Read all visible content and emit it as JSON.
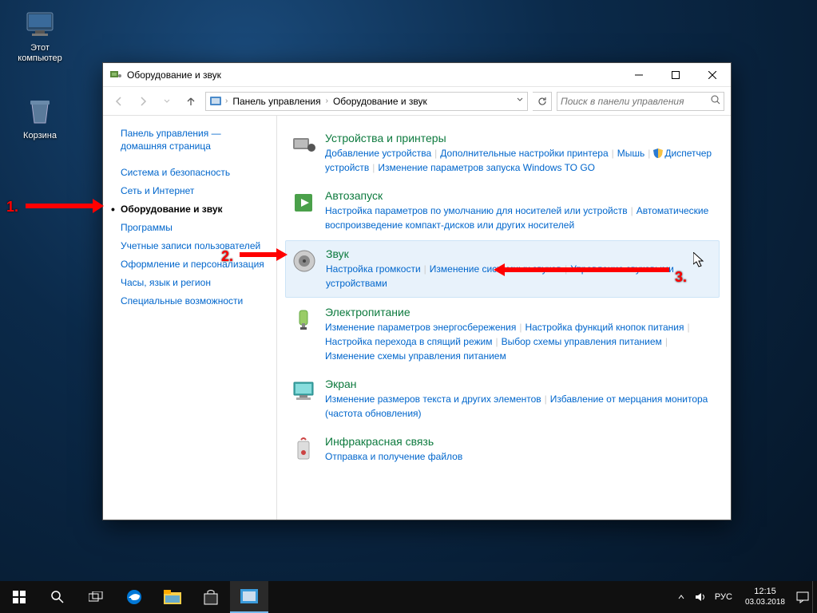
{
  "desktop": {
    "this_pc": "Этот\nкомпьютер",
    "recycle": "Корзина"
  },
  "window": {
    "title": "Оборудование и звук",
    "breadcrumb": {
      "root": "Панель управления",
      "current": "Оборудование и звук"
    },
    "search_placeholder": "Поиск в панели управления"
  },
  "sidebar": {
    "home": "Панель управления — домашняя страница",
    "items": [
      "Система и безопасность",
      "Сеть и Интернет",
      "Оборудование и звук",
      "Программы",
      "Учетные записи пользователей",
      "Оформление и персонализация",
      "Часы, язык и регион",
      "Специальные возможности"
    ],
    "active_index": 2
  },
  "categories": [
    {
      "title": "Устройства и принтеры",
      "links": [
        "Добавление устройства",
        "Дополнительные настройки принтера",
        "Мышь",
        "Диспетчер устройств",
        "Изменение параметров запуска Windows TO GO"
      ],
      "shield_index": 3
    },
    {
      "title": "Автозапуск",
      "links": [
        "Настройка параметров по умолчанию для носителей или устройств",
        "Автоматические воспроизведение компакт-дисков или других носителей"
      ]
    },
    {
      "title": "Звук",
      "links": [
        "Настройка громкости",
        "Изменение системных звуков",
        "Управление звуковыми устройствами"
      ],
      "highlight": true
    },
    {
      "title": "Электропитание",
      "links": [
        "Изменение параметров энергосбережения",
        "Настройка функций кнопок питания",
        "Настройка перехода в спящий режим",
        "Выбор схемы управления питанием",
        "Изменение схемы управления питанием"
      ]
    },
    {
      "title": "Экран",
      "links": [
        "Изменение размеров текста и других элементов",
        "Избавление от мерцания монитора (частота обновления)"
      ]
    },
    {
      "title": "Инфракрасная связь",
      "links": [
        "Отправка и получение файлов"
      ]
    }
  ],
  "annotations": {
    "n1": "1.",
    "n2": "2.",
    "n3": "3."
  },
  "taskbar": {
    "lang": "РУС",
    "time": "12:15",
    "date": "03.03.2018"
  }
}
